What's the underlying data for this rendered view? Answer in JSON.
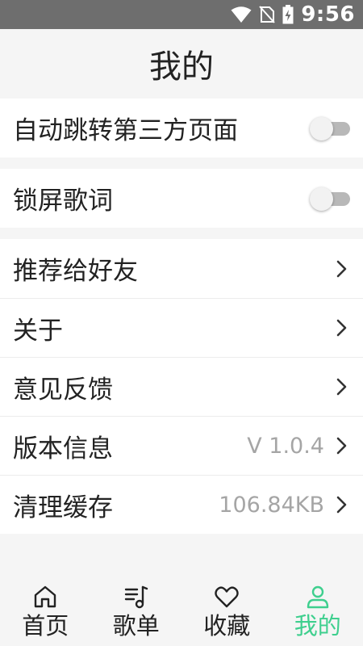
{
  "status_bar": {
    "time": "9:56",
    "icons": [
      "wifi-icon",
      "no-sim-icon",
      "battery-charging-icon"
    ]
  },
  "page": {
    "title": "我的"
  },
  "settings": {
    "auto_jump": {
      "label": "自动跳转第三方页面",
      "enabled": false
    },
    "lock_lyrics": {
      "label": "锁屏歌词",
      "enabled": false
    }
  },
  "menu": {
    "recommend": {
      "label": "推荐给好友"
    },
    "about": {
      "label": "关于"
    },
    "feedback": {
      "label": "意见反馈"
    },
    "version": {
      "label": "版本信息",
      "value": "V 1.0.4"
    },
    "cache": {
      "label": "清理缓存",
      "value": "106.84KB"
    }
  },
  "bottom_nav": {
    "items": [
      {
        "label": "首页",
        "icon": "home-icon",
        "active": false
      },
      {
        "label": "歌单",
        "icon": "playlist-icon",
        "active": false
      },
      {
        "label": "收藏",
        "icon": "heart-icon",
        "active": false
      },
      {
        "label": "我的",
        "icon": "user-icon",
        "active": true
      }
    ]
  },
  "colors": {
    "accent": "#3ecf8e",
    "status_bar": "#6e6e6e",
    "background": "#f5f5f5"
  }
}
